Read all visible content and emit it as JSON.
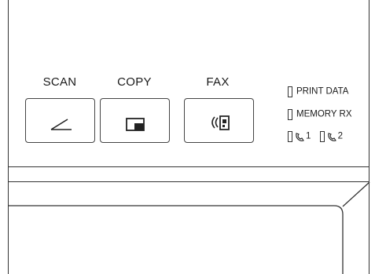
{
  "buttons": [
    {
      "id": "scan",
      "label": "SCAN",
      "icon": "scan-icon"
    },
    {
      "id": "copy",
      "label": "COPY",
      "icon": "copy-icon"
    },
    {
      "id": "fax",
      "label": "FAX",
      "icon": "fax-icon"
    }
  ],
  "indicators": {
    "print_data": "PRINT DATA",
    "memory_rx": "MEMORY RX",
    "line1": "1",
    "line2": "2"
  }
}
